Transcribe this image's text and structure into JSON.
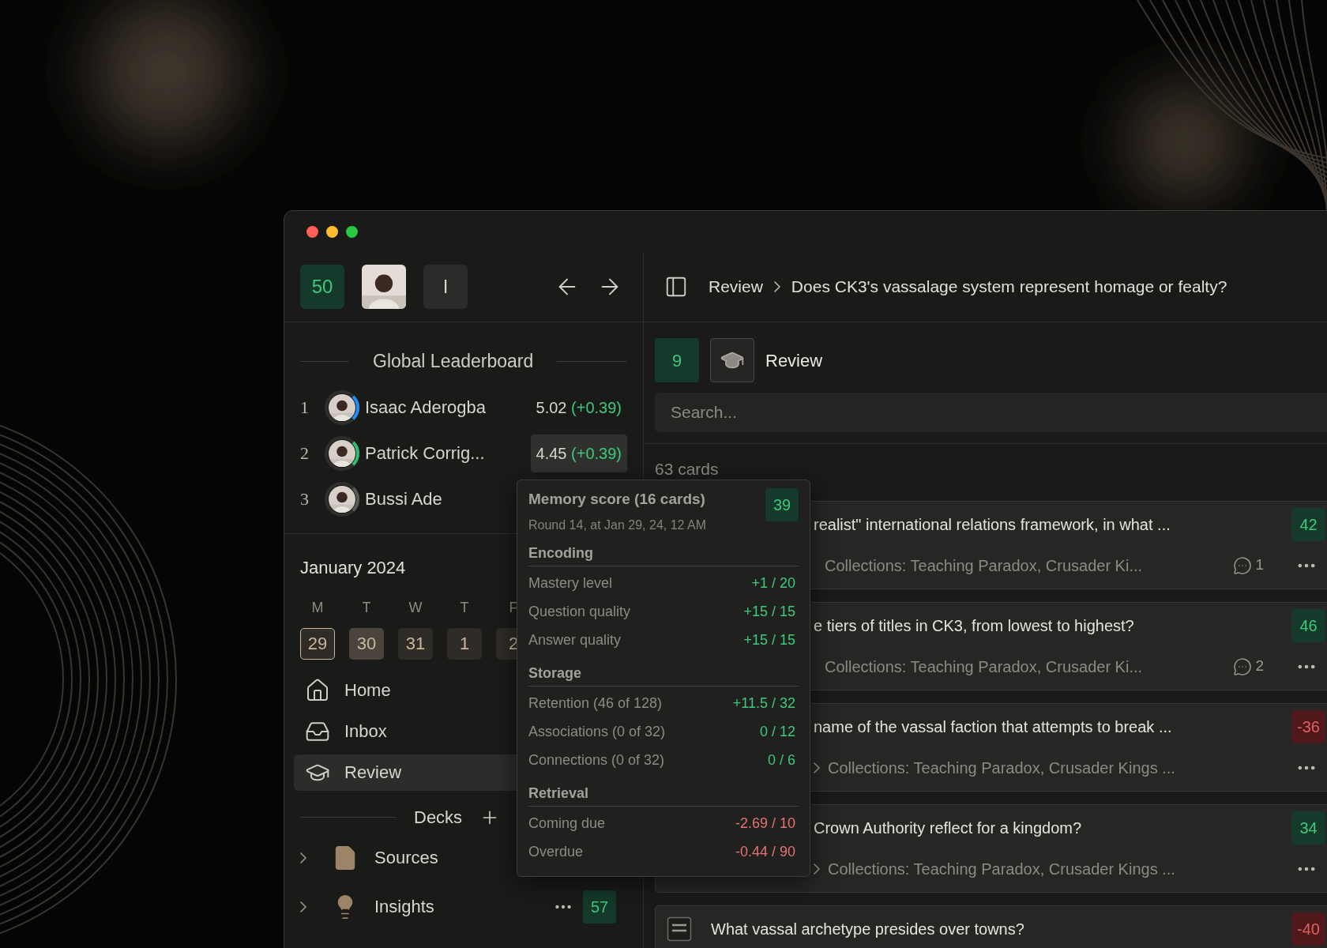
{
  "toolbar": {
    "streak": "50",
    "initial": "I"
  },
  "leaderboard": {
    "title": "Global Leaderboard",
    "rows": [
      {
        "rank": "1",
        "name": "Isaac Aderogba",
        "score": "5.02",
        "delta": "(+0.39)",
        "color": "#1e8fff",
        "selected": false
      },
      {
        "rank": "2",
        "name": "Patrick Corrig...",
        "score": "4.45",
        "delta": "(+0.39)",
        "color": "#2fbf71",
        "selected": true
      },
      {
        "rank": "3",
        "name": "Bussi Ade",
        "color": "#5a5a58",
        "selected": false
      }
    ]
  },
  "calendar": {
    "title": "January 2024",
    "weekdays": [
      "M",
      "T",
      "W",
      "T",
      "F"
    ],
    "days": [
      {
        "label": "29",
        "selected": true,
        "highlighted": false
      },
      {
        "label": "30",
        "selected": false,
        "highlighted": true
      },
      {
        "label": "31",
        "selected": false,
        "highlighted": false
      },
      {
        "label": "1",
        "selected": false,
        "highlighted": false
      },
      {
        "label": "2",
        "selected": false,
        "highlighted": false
      }
    ]
  },
  "nav": [
    {
      "label": "Home",
      "kind": "home",
      "selected": false
    },
    {
      "label": "Inbox",
      "kind": "inbox",
      "selected": false
    },
    {
      "label": "Review",
      "kind": "review",
      "selected": true
    }
  ],
  "decks": {
    "title": "Decks",
    "items": [
      {
        "label": "Sources",
        "kind": "sources",
        "expanded": false
      },
      {
        "label": "Insights",
        "kind": "insights",
        "expanded": false,
        "show_menu": true,
        "count": "57"
      }
    ]
  },
  "breadcrumb": [
    "Review",
    "Does CK3's vassalage system represent homage or fealty?"
  ],
  "review_header": {
    "count": "9",
    "title": "Review"
  },
  "search": {
    "placeholder": "Search..."
  },
  "card_count": "63 cards",
  "cards": [
    {
      "kind": "plain",
      "title": "realist\" international relations framework, in what ...",
      "score": "42",
      "negative": false,
      "collections": "Collections: Teaching Paradox, Crusader Ki...",
      "comments": "1"
    },
    {
      "kind": "plain",
      "title": "e tiers of titles in CK3, from lowest to highest?",
      "score": "46",
      "negative": false,
      "collections": "Collections: Teaching Paradox, Crusader Ki...",
      "comments": "2"
    },
    {
      "kind": "nested",
      "title": "name of the vassal faction that attempts to break ...",
      "score": "-36",
      "negative": true,
      "collections": "Collections: Teaching Paradox, Crusader Kings ..."
    },
    {
      "kind": "nested",
      "title": "Crown Authority reflect for a kingdom?",
      "score": "34",
      "negative": false,
      "collections": "Collections: Teaching Paradox, Crusader Kings ..."
    },
    {
      "kind": "doc",
      "title": "What vassal archetype presides over towns?",
      "score": "-40",
      "negative": true
    }
  ],
  "tooltip": {
    "title": "Memory score (16 cards)",
    "subtitle": "Round 14, at Jan 29, 24, 12 AM",
    "score": "39",
    "negative": false,
    "sections": [
      {
        "heading": "Encoding",
        "rows": [
          {
            "label": "Mastery level",
            "value": "+1 / 20",
            "color": "#3ec97a"
          },
          {
            "label": "Question quality",
            "value": "+15 / 15",
            "color": "#3ec97a"
          },
          {
            "label": "Answer quality",
            "value": "+15 / 15",
            "color": "#3ec97a"
          }
        ]
      },
      {
        "heading": "Storage",
        "rows": [
          {
            "label": "Retention (46 of 128)",
            "value": "+11.5 / 32",
            "color": "#3ec97a"
          },
          {
            "label": "Associations (0 of 32)",
            "value": "0 / 12",
            "color": "#3ec97a"
          },
          {
            "label": "Connections (0 of 32)",
            "value": "0 / 6",
            "color": "#3ec97a"
          }
        ]
      },
      {
        "heading": "Retrieval",
        "rows": [
          {
            "label": "Coming due",
            "value": "-2.69 / 10",
            "color": "#e87272"
          },
          {
            "label": "Overdue",
            "value": "-0.44 / 90",
            "color": "#e87272"
          }
        ]
      }
    ]
  }
}
